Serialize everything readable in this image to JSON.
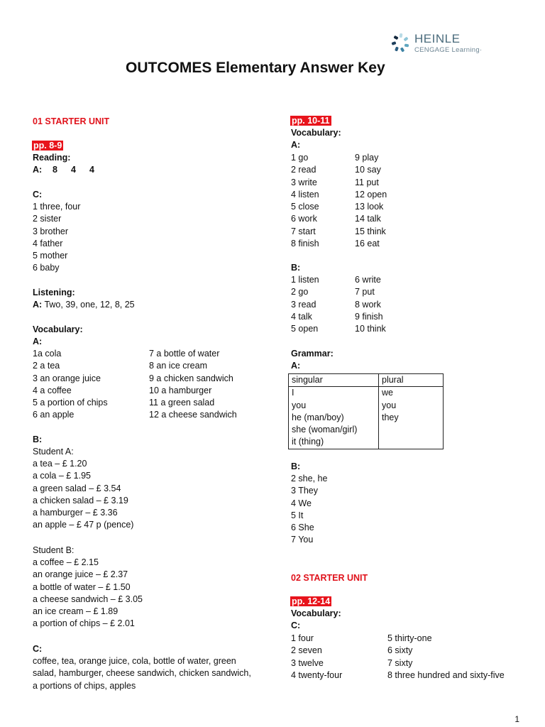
{
  "header": {
    "logo": {
      "line1": "HEINLE",
      "line2": "CENGAGE Learning",
      "trademark": "·"
    },
    "title": "OUTCOMES Elementary Answer Key"
  },
  "colors": {
    "unit_heading": "#e0121b",
    "page_highlight": "#e8141c"
  },
  "left": {
    "unit_heading": "01 STARTER UNIT",
    "page_ref": "pp. 8-9",
    "reading": {
      "label": "Reading:",
      "a_label": "A:",
      "a_values": [
        "8",
        "4",
        "4"
      ],
      "c_label": "C:",
      "c_items": [
        "1 three, four",
        "2 sister",
        "3 brother",
        "4 father",
        "5 mother",
        "6 baby"
      ]
    },
    "listening": {
      "label": "Listening:",
      "a_label": "A:",
      "a_text": " Two, 39, one, 12, 8, 25"
    },
    "vocabulary": {
      "label": "Vocabulary:",
      "a_label": "A:",
      "a_col1": [
        "1a cola",
        "2 a tea",
        "3 an orange juice",
        "4 a coffee",
        "5 a portion of chips",
        "6 an apple"
      ],
      "a_col2": [
        "7 a bottle of water",
        "8 an ice cream",
        "9 a chicken sandwich",
        "10 a hamburger",
        "11 a green salad",
        "12 a cheese sandwich"
      ],
      "b_label": "B:",
      "student_a_label": "Student A:",
      "student_a": [
        "a tea – £ 1.20",
        "a cola – £ 1.95",
        "a green salad – £ 3.54",
        "a chicken salad – £ 3.19",
        "a hamburger – £ 3.36",
        "an apple – £ 47 p (pence)"
      ],
      "student_b_label": "Student B:",
      "student_b": [
        "a coffee – £ 2.15",
        "an orange juice – £ 2.37",
        "a bottle of water – £ 1.50",
        "a cheese sandwich – £ 3.05",
        "an ice cream – £ 1.89",
        "a portion of chips – £ 2.01"
      ],
      "c_label": "C:",
      "c_lines": [
        "coffee, tea, orange juice, cola, bottle of water, green",
        "salad, hamburger, cheese sandwich, chicken sandwich,",
        "a portions of chips, apples"
      ]
    }
  },
  "right": {
    "page_ref": "pp. 10-11",
    "vocabulary": {
      "label": "Vocabulary:",
      "a_label": "A:",
      "a_col1": [
        "1 go",
        "2 read",
        "3 write",
        "4 listen",
        "5 close",
        "6 work",
        "7 start",
        "8 finish"
      ],
      "a_col2": [
        "9 play",
        "10 say",
        "11 put",
        "12 open",
        "13 look",
        "14 talk",
        "15 think",
        "16 eat"
      ],
      "b_label": "B:",
      "b_col1": [
        "1 listen",
        "2 go",
        "3 read",
        "4 talk",
        "5 open"
      ],
      "b_col2": [
        "6 write",
        "7 put",
        "8 work",
        "9 finish",
        "10 think"
      ]
    },
    "grammar": {
      "label": "Grammar:",
      "a_label": "A:",
      "table": {
        "headers": [
          "singular",
          "plural"
        ],
        "singular": [
          "I",
          "you",
          "he (man/boy)",
          "she (woman/girl)",
          "it (thing)"
        ],
        "plural": [
          "we",
          "you",
          "they"
        ]
      },
      "b_label": "B:",
      "b_items": [
        "2 she, he",
        "3 They",
        "4 We",
        "5 It",
        "6 She",
        "7 You"
      ]
    },
    "unit2": {
      "unit_heading": "02 STARTER UNIT",
      "page_ref": "pp. 12-14",
      "vocab_label": "Vocabulary:",
      "c_label": "C:",
      "c_col1": [
        "1 four",
        "2 seven",
        "3 twelve",
        "4 twenty-four"
      ],
      "c_col2": [
        "5 thirty-one",
        "6 sixty",
        "7 sixty",
        "8 three hundred and sixty-five"
      ]
    }
  },
  "footer": {
    "page_number": "1"
  }
}
